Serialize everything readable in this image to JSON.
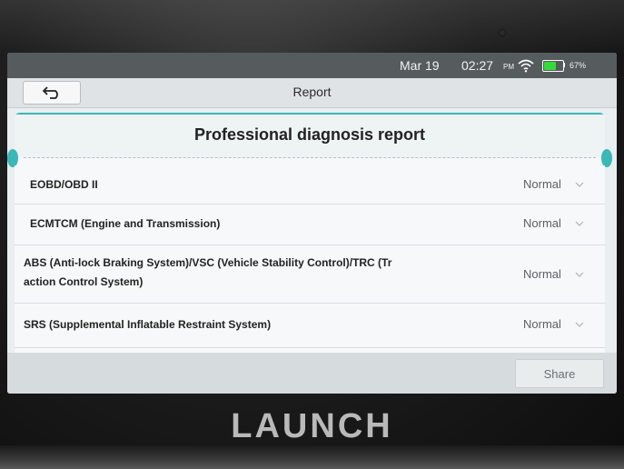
{
  "status_bar": {
    "date": "Mar 19",
    "time": "02:27",
    "ampm": "PM",
    "battery_percent": "67%",
    "battery_level": 0.67,
    "wifi_icon": "wifi-icon",
    "battery_color": "#35d93b"
  },
  "title_bar": {
    "back_icon": "back-arrow-icon",
    "title": "Report"
  },
  "report": {
    "title": "Professional diagnosis report",
    "rows": [
      {
        "label": "EOBD/OBD II",
        "status": "Normal"
      },
      {
        "label": "ECMTCM (Engine and Transmission)",
        "status": "Normal"
      },
      {
        "label_line1": "ABS (Anti-lock Braking System)/VSC (Vehicle Stability Control)/TRC (Tr",
        "label_line2": "action Control System)",
        "status": "Normal"
      },
      {
        "label": "SRS (Supplemental Inflatable Restraint System)",
        "status": "Normal"
      }
    ]
  },
  "footer": {
    "share_label": "Share"
  },
  "device": {
    "brand": "LAUNCH"
  },
  "colors": {
    "accent": "#3ab7b6",
    "status_bar": "#565b5e"
  }
}
